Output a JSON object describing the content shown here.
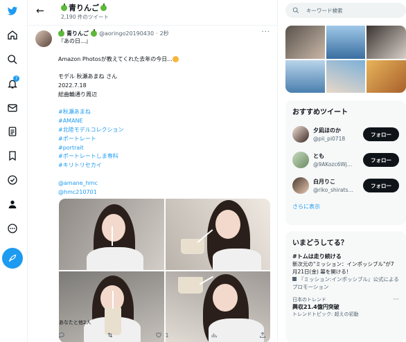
{
  "header": {
    "name": "青りんご",
    "tweet_count": "2,190 件のツイート"
  },
  "nav": {
    "notification_count": "7"
  },
  "tweet": {
    "name": "青りんご",
    "handle": "@aoringo20190430",
    "separator": "·",
    "time": "2秒",
    "more": "···",
    "lines": [
      "『あの日...』",
      "",
      "Amazon Photosが教えてくれた去年の今日...",
      "",
      "モデル 秋瀬あまね さん",
      "2022.7.18",
      "総曲輪通り周辺"
    ],
    "hashtags": [
      "#秋瀬あまね",
      "#AMANE",
      "#北陸モデルコレクション",
      "#ポートレート",
      "#portrait",
      "#ポートレートしま専科",
      "#キリトリセカイ"
    ],
    "mentions": [
      "@amane_hmc",
      "@hmc210701"
    ],
    "liked_by": "あなたと他2人",
    "like_count": "1"
  },
  "search": {
    "placeholder": "キーワード検索"
  },
  "recommended": {
    "title": "おすすめツイート",
    "users": [
      {
        "name": "夕凪ほのか",
        "handle": "@pii_pi0718",
        "follow": "フォロー"
      },
      {
        "name": "とも",
        "handle": "@9AKozc6Wj…",
        "follow": "フォロー"
      },
      {
        "name": "白月りこ",
        "handle": "@riko_shirats…",
        "follow": "フォロー"
      }
    ],
    "show_more": "さらに表示"
  },
  "trends": {
    "title": "いまどうしてる？",
    "item1": {
      "headline": "#トムは走り続ける",
      "text": "新次元の\"ミッション：インポッシブル\"が7月21日(金) 幕を開ける！",
      "promoted_by": "『ミッション:インポッシブル』公式によるプロモーション"
    },
    "item2": {
      "category": "日本のトレンド",
      "headline": "興収21.4億円突破",
      "topic_prefix": "トレンドトピック:",
      "topic_link": "超えの初動",
      "more": "···"
    }
  },
  "colors": {
    "accent": "#1d9bf0",
    "text": "#0f1419",
    "secondary": "#536471"
  }
}
